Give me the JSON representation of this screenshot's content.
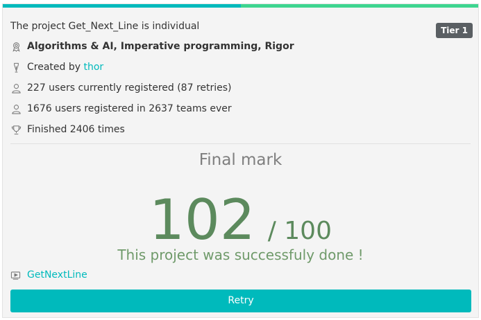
{
  "colors": {
    "accent": "#00babc",
    "accent_secondary": "#3ed590",
    "mark": "#5c8a5d",
    "tier_badge": "#5a5f63"
  },
  "project": {
    "title": "The project Get_Next_Line is individual",
    "tier": "Tier 1"
  },
  "info": {
    "skills": {
      "icon": "skills-icon",
      "text": "Algorithms & AI, Imperative programming, Rigor"
    },
    "creator": {
      "icon": "pen-icon",
      "prefix": "Created by",
      "name": "thor"
    },
    "current_registered": {
      "icon": "user-icon",
      "text": "227 users currently registered (87 retries)"
    },
    "total_registered": {
      "icon": "user-icon",
      "text": "1676 users registered in 2637 teams ever"
    },
    "finished": {
      "icon": "trophy-icon",
      "text": "Finished 2406 times"
    }
  },
  "result": {
    "label": "Final mark",
    "mark": "102",
    "max": "/ 100",
    "message": "This project was successfuly done !"
  },
  "repo": {
    "icon": "video-icon",
    "link_text": "GetNextLine"
  },
  "actions": {
    "retry_label": "Retry"
  }
}
